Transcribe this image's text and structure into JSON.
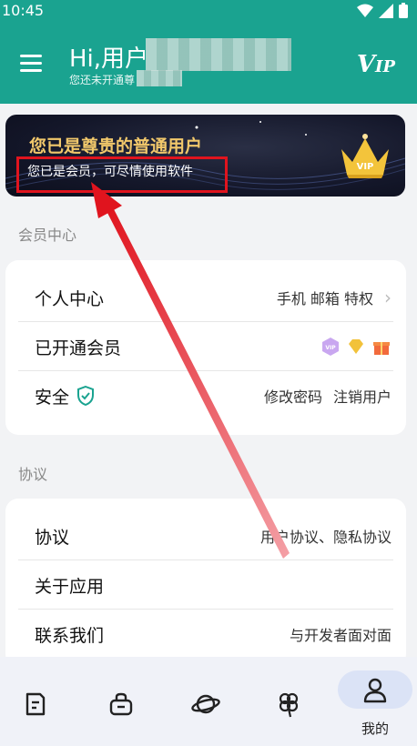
{
  "status": {
    "time": "10:45"
  },
  "header": {
    "greeting": "Hi,用户",
    "subtitle": "您还未开通尊",
    "vip_logo": "VIP"
  },
  "banner": {
    "title": "您已是尊贵的普通用户",
    "subtitle": "您已是会员，可尽情使用软件",
    "badge": "VIP"
  },
  "sections": {
    "member_center": "会员中心",
    "agreement": "协议"
  },
  "member_rows": [
    {
      "label": "个人中心",
      "value": "手机 邮箱 特权"
    },
    {
      "label": "已开通会员",
      "value": ""
    },
    {
      "label": "安全",
      "value_a": "修改密码",
      "value_b": "注销用户"
    }
  ],
  "agreement_rows": [
    {
      "label": "协议",
      "value": "用户协议、隐私协议"
    },
    {
      "label": "关于应用",
      "value": ""
    },
    {
      "label": "联系我们",
      "value": "与开发者面对面"
    }
  ],
  "nav": {
    "items": [
      "document-icon",
      "bag-icon",
      "planet-icon",
      "clover-icon",
      "person-icon"
    ],
    "active_label": "我的"
  },
  "colors": {
    "accent": "#1aa390",
    "gold": "#f1c86b",
    "highlight": "#e0141e"
  }
}
